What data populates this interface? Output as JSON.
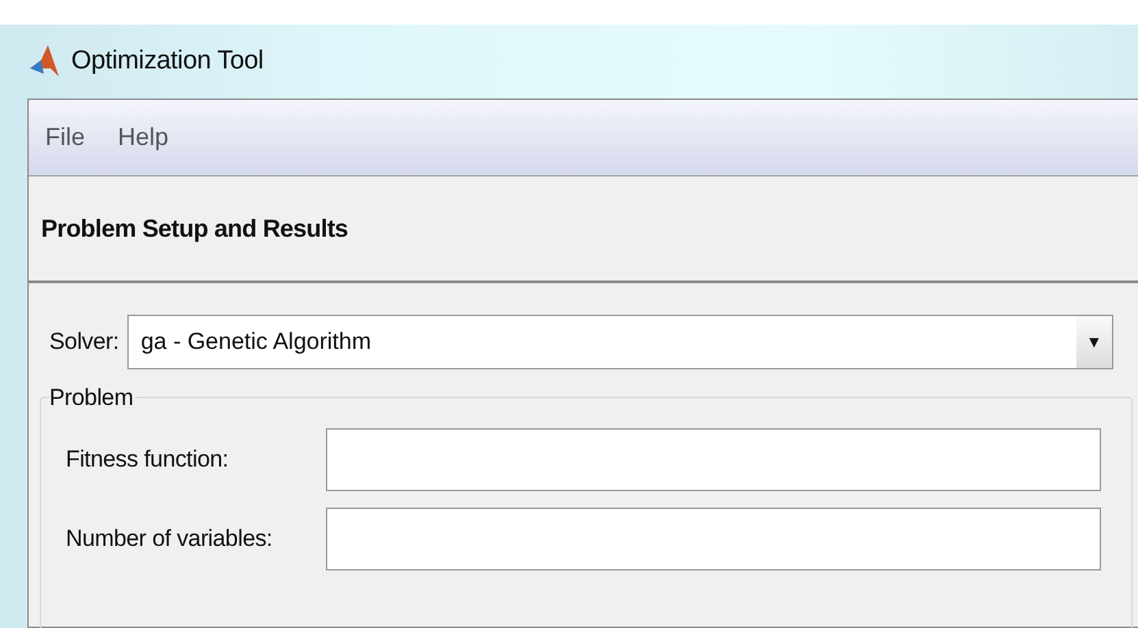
{
  "window": {
    "title": "Optimization Tool"
  },
  "menu": [
    "File",
    "Help"
  ],
  "panel": {
    "title": "Problem Setup and Results"
  },
  "solver": {
    "label": "Solver:",
    "value": "ga - Genetic Algorithm",
    "arrow": "▼"
  },
  "problem": {
    "title": "Problem",
    "fields": [
      {
        "label": "Fitness function:"
      },
      {
        "label": "Number of variables:"
      }
    ]
  }
}
